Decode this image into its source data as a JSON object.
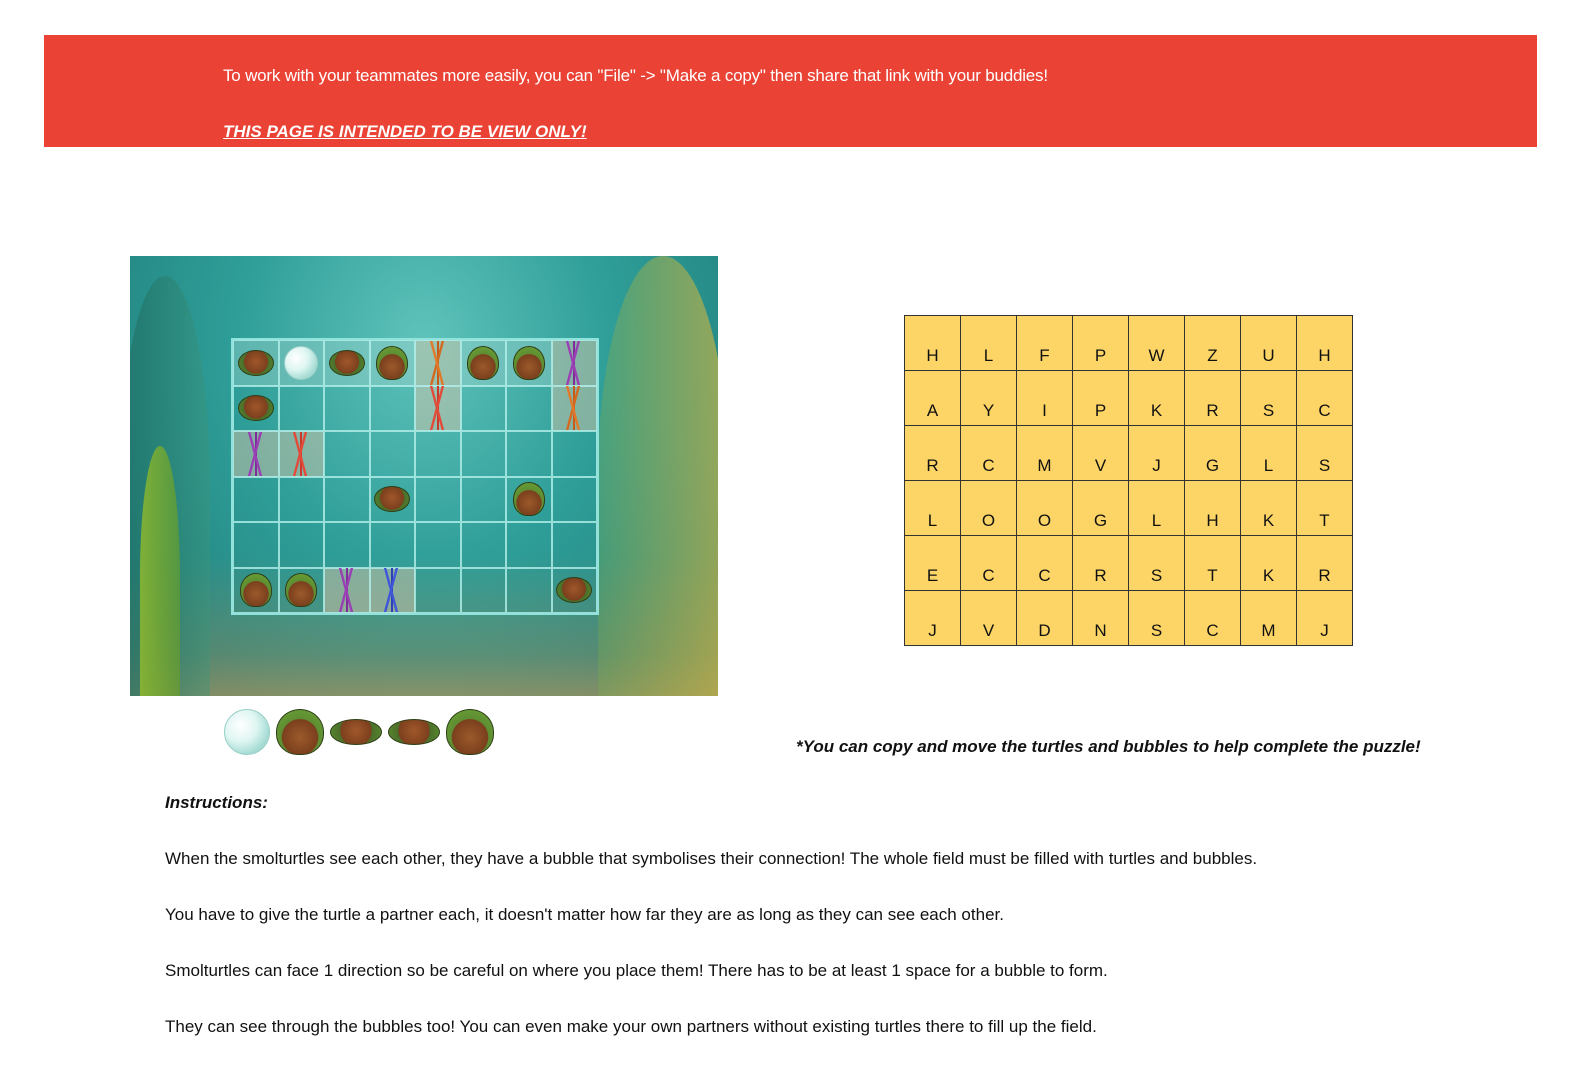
{
  "banner": {
    "message": "To work with your teammates more easily, you can \"File\" -> \"Make a copy\" then share that link with your buddies!",
    "warning": "THIS PAGE IS INTENDED TO BE VIEW ONLY!"
  },
  "board": {
    "rows": 6,
    "cols": 8,
    "cells": [
      [
        "turtle-side",
        "bubble",
        "turtle-side",
        "turtle-front",
        "coral-orange",
        "turtle-front",
        "turtle-front",
        "coral-purple"
      ],
      [
        "turtle-side",
        "",
        "",
        "",
        "coral-red",
        "",
        "",
        "coral-orange"
      ],
      [
        "coral-purple",
        "coral-red",
        "",
        "",
        "",
        "",
        "",
        ""
      ],
      [
        "",
        "",
        "",
        "turtle-side",
        "",
        "",
        "turtle-front",
        ""
      ],
      [
        "",
        "",
        "",
        "",
        "",
        "",
        "",
        ""
      ],
      [
        "turtle-front",
        "turtle-front",
        "coral-purple",
        "coral-blue",
        "",
        "",
        "",
        "turtle-side"
      ]
    ]
  },
  "palette": {
    "items": [
      "bubble-icon",
      "turtle-front-large-icon",
      "turtle-side-icon",
      "turtle-side-icon",
      "turtle-front-icon"
    ]
  },
  "letter_grid": [
    [
      "H",
      "L",
      "F",
      "P",
      "W",
      "Z",
      "U",
      "H"
    ],
    [
      "A",
      "Y",
      "I",
      "P",
      "K",
      "R",
      "S",
      "C"
    ],
    [
      "R",
      "C",
      "M",
      "V",
      "J",
      "G",
      "L",
      "S"
    ],
    [
      "L",
      "O",
      "O",
      "G",
      "L",
      "H",
      "K",
      "T"
    ],
    [
      "E",
      "C",
      "C",
      "R",
      "S",
      "T",
      "K",
      "R"
    ],
    [
      "J",
      "V",
      "D",
      "N",
      "S",
      "C",
      "M",
      "J"
    ]
  ],
  "note": "*You can copy and move the turtles and bubbles to help complete the puzzle!",
  "instructions": {
    "heading": "Instructions:",
    "lines": [
      "When the smolturtles see each other, they have a bubble that symbolises their connection! The whole field must be filled with turtles and bubbles.",
      "You have to give the turtle a partner each, it doesn't matter how far they are as long as they can see each other.",
      "Smolturtles can face 1 direction so be careful on where you place them! There has to be at least 1 space for a bubble to form.",
      "They can see through the bubbles too! You can even make your own partners without existing turtles there to fill up the field."
    ]
  },
  "colors": {
    "banner": "#ea4335",
    "letter_cell": "#fdd566",
    "water": "#2f9e98"
  }
}
